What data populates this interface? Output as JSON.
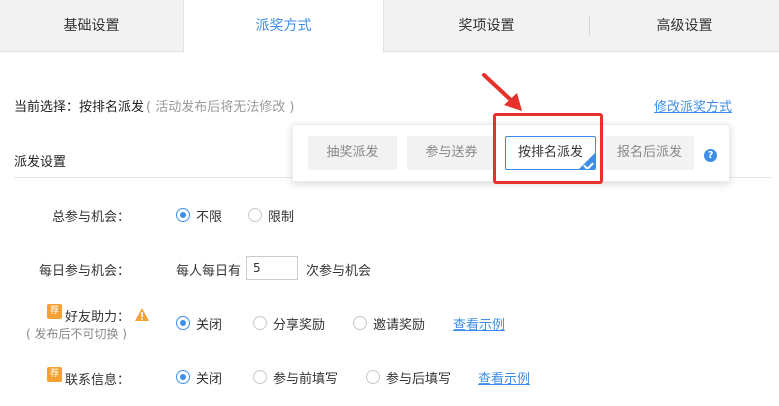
{
  "tabs": [
    {
      "label": "基础设置",
      "active": false
    },
    {
      "label": "派奖方式",
      "active": true
    },
    {
      "label": "奖项设置",
      "active": false
    },
    {
      "label": "高级设置",
      "active": false
    }
  ],
  "current": {
    "label": "当前选择：",
    "value": "按排名派发",
    "note": "( 活动发布后将无法修改 )",
    "modify_link": "修改派奖方式"
  },
  "popover": {
    "options": [
      "抽奖派发",
      "参与送券",
      "按排名派发",
      "报名后派发"
    ],
    "selected": "按排名派发",
    "help": "?"
  },
  "section": {
    "title": "派发设置"
  },
  "total_chances": {
    "label": "总参与机会：",
    "options": [
      "不限",
      "限制"
    ],
    "selected": "不限"
  },
  "daily_chances": {
    "label": "每日参与机会：",
    "prefix": "每人每日有",
    "value": "5",
    "suffix": "次参与机会"
  },
  "friend_help": {
    "badge": "荐",
    "label": "好友助力：",
    "sub_note": "( 发布后不可切换 )",
    "options": [
      "关闭",
      "分享奖励",
      "邀请奖励"
    ],
    "selected": "关闭",
    "example_link": "查看示例"
  },
  "contact_info": {
    "badge": "荐",
    "label": "联系信息：",
    "options": [
      "关闭",
      "参与前填写",
      "参与后填写"
    ],
    "selected": "关闭",
    "example_link": "查看示例"
  },
  "colors": {
    "accent": "#3d8ee8",
    "highlight": "#e8312a",
    "badge": "#f5a034",
    "warning": "#f5a034"
  }
}
